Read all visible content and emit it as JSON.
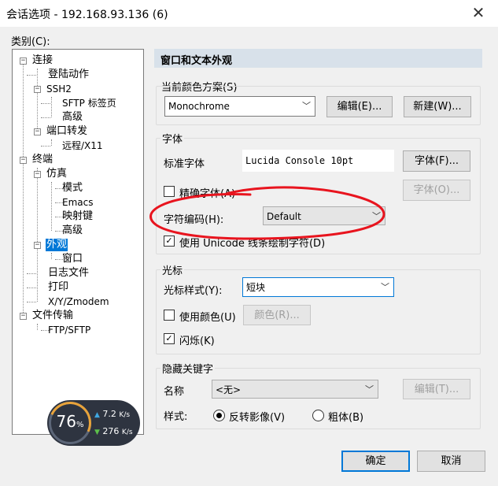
{
  "window": {
    "title": "会话选项 - 192.168.93.136 (6)",
    "close": "✕"
  },
  "left": {
    "category_label": "类别(C):",
    "tree": {
      "connect": "连接",
      "login_actions": "登陆动作",
      "ssh2": "SSH2",
      "sftp_tab": "SFTP 标签页",
      "advanced1": "高级",
      "port_forward": "端口转发",
      "remote_x11": "远程/X11",
      "terminal": "终端",
      "emulation": "仿真",
      "mode": "模式",
      "emacs": "Emacs",
      "mapped_keys": "映射键",
      "advanced2": "高级",
      "appearance": "外观",
      "window": "窗口",
      "log_file": "日志文件",
      "print": "打印",
      "xyz": "X/Y/Zmodem",
      "file_transfer": "文件传输",
      "ftp_sftp": "FTP/SFTP"
    }
  },
  "speed_widget": {
    "percent": "76",
    "percent_unit": "%",
    "up_value": "7.2",
    "up_unit": "K/s",
    "down_value": "276",
    "down_unit": "K/s"
  },
  "right": {
    "header": "窗口和文本外观",
    "color_scheme": {
      "title": "当前颜色方案(S)",
      "value": "Monochrome",
      "edit": "编辑(E)...",
      "new": "新建(W)..."
    },
    "font": {
      "title": "字体",
      "standard_label": "标准字体",
      "standard_value": "Lucida Console 10pt",
      "font_button": "字体(F)...",
      "precise_label": "精确字体(A)",
      "precise_button": "字体(O)...",
      "encoding_label": "字符编码(H):",
      "encoding_value": "Default",
      "unicode_label": "使用 Unicode 线条绘制字符(D)"
    },
    "cursor": {
      "title": "光标",
      "style_label": "光标样式(Y):",
      "style_value": "短块",
      "use_color_label": "使用颜色(U)",
      "color_button": "颜色(R)...",
      "blink_label": "闪烁(K)"
    },
    "hidden_keyword": {
      "title": "隐藏关键字",
      "name_label": "名称",
      "name_value": "<无>",
      "edit": "编辑(T)...",
      "style_label": "样式:",
      "reverse_label": "反转影像(V)",
      "bold_label": "粗体(B)"
    }
  },
  "footer": {
    "ok": "确定",
    "cancel": "取消"
  },
  "colors": {
    "accent": "#0078d7",
    "annotation": "#e8141e",
    "header_bg": "#d8e1ea"
  }
}
